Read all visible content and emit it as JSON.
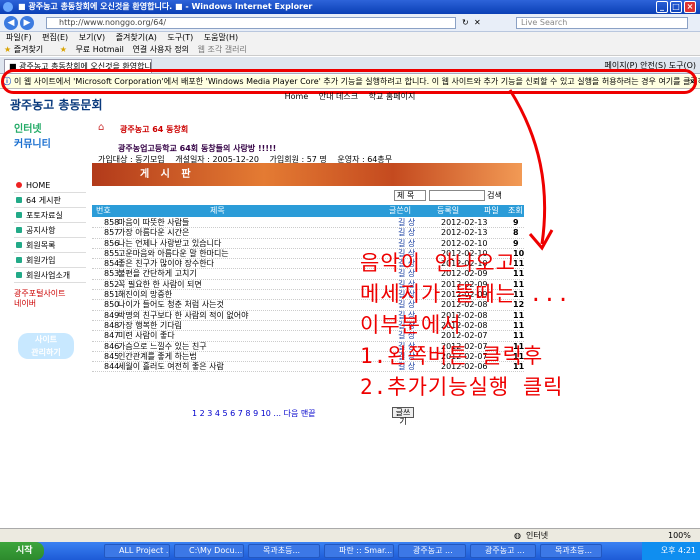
{
  "window": {
    "title": "■ 광주농고 총동창회에 오신것을 환영합니다. ■ - Windows Internet Explorer"
  },
  "addressbar": {
    "url": "http://www.nonggo.org/64/",
    "search_placeholder": "Live Search"
  },
  "menubar": {
    "items": [
      "파일(F)",
      "편집(E)",
      "보기(V)",
      "즐겨찾기(A)",
      "도구(T)",
      "도움말(H)"
    ]
  },
  "favbar": {
    "favorites": "즐겨찾기",
    "items": [
      "무료 Hotmail",
      "연결 사용자 정의",
      "웹 조각 갤러리"
    ]
  },
  "tabs": {
    "active": "■ 광주농고 총동창회에 오신것을 환영합니다.",
    "tools": "페이지(P)  안전(S)  도구(O)"
  },
  "infobar": {
    "text": "이 웹 사이트에서 'Microsoft Corporation'에서 배포한 'Windows Media Player Core' 추가 기능을 실행하려고 합니다. 이 웹 사이트와 추가 기능을 신뢰할 수 있고 실행을 허용하려는 경우 여기를 클릭하십시오.",
    "close": "×"
  },
  "site": {
    "topnav": [
      "Home",
      "안내 데스크",
      "학교 홈페이지"
    ],
    "name": "광주농고 총동문회",
    "logo": [
      "인터넷",
      "커뮤니티"
    ],
    "nav": [
      "HOME",
      "64 게시판",
      "포토자료실",
      "공지사항",
      "회원목록",
      "회원가입",
      "회원사업소개"
    ],
    "extra_links": [
      "광주포털사이트",
      "네이버"
    ],
    "badge": [
      "사이트",
      "관리하기"
    ]
  },
  "main": {
    "title": "광주농고 64 동창회",
    "desc": "광주농업고등학교 64회 동창들의 사랑방 !!!!!",
    "info": [
      "가입대상 : 동기모임",
      "개설일자 : 2005-12-20",
      "가입회원 : 57 명",
      "운영자 : 64총무"
    ],
    "board_banner": "게 시 판",
    "search_select": "제 목",
    "search_btn": "검색",
    "columns": [
      "번호",
      "제목",
      "글쓴이",
      "등록일",
      "파일",
      "조회"
    ],
    "rows": [
      {
        "no": "858",
        "title": "마음이 따뜻한 사람들",
        "author": "길 상",
        "date": "2012-02-13",
        "views": "9"
      },
      {
        "no": "857",
        "title": "가장 아름다운 시간은",
        "author": "길 상",
        "date": "2012-02-13",
        "views": "8"
      },
      {
        "no": "856",
        "title": "나는 언제나 사랑받고 있습니다",
        "author": "길 상",
        "date": "2012-02-10",
        "views": "9"
      },
      {
        "no": "855",
        "title": "고운마음와 아름다운 말 한마디는",
        "author": "길 상",
        "date": "2012-02-10",
        "views": "10"
      },
      {
        "no": "854",
        "title": "좋은 친구가 많이야 장수한다",
        "author": "길 상",
        "date": "2012-02-10",
        "views": "11"
      },
      {
        "no": "853",
        "title": "불편을 간단하게 고치기",
        "author": "길 상",
        "date": "2012-02-09",
        "views": "11"
      },
      {
        "no": "852",
        "title": "꼭 필요한 한 사람이 되면",
        "author": "길 상",
        "date": "2012-02-09",
        "views": "11"
      },
      {
        "no": "851",
        "title": "해진이의 망중한",
        "author": "길 상",
        "date": "2012-02-09",
        "views": "11"
      },
      {
        "no": "850",
        "title": "나이가 들어도 청춘 처럼 사는것",
        "author": "길 상",
        "date": "2012-02-08",
        "views": "12"
      },
      {
        "no": "849",
        "title": "박명의 친구보다 한 사람의 적이 없어야",
        "author": "길 상",
        "date": "2012-02-08",
        "views": "11"
      },
      {
        "no": "848",
        "title": "가장 행복한 기다림",
        "author": "길 상",
        "date": "2012-02-08",
        "views": "11"
      },
      {
        "no": "847",
        "title": "미련 사람이 좋다",
        "author": "길 상",
        "date": "2012-02-07",
        "views": "11"
      },
      {
        "no": "846",
        "title": "가슴으로 느낄수 있는 친구",
        "author": "길 상",
        "date": "2012-02-07",
        "views": "11"
      },
      {
        "no": "845",
        "title": "인간관계를 좋게 하는법",
        "author": "길 상",
        "date": "2012-02-07",
        "views": "11"
      },
      {
        "no": "844",
        "title": "세월이 흘러도 여전히 좋은 사람",
        "author": "길 상",
        "date": "2012-02-06",
        "views": "11"
      }
    ],
    "pager": "1 2 3 4 5 6 7 8 9 10 ... 다음 맨끝",
    "write_btn": "글쓰기"
  },
  "overlay": {
    "lines": [
      "음악이 안나오고",
      "메세지가 뜰때는 ...",
      "이부분에서",
      "1.왼쪽버튼 클릭후",
      "2.추가기능실행 클릭"
    ]
  },
  "statusbar": {
    "zone": "인터넷",
    "zoom": "100%"
  },
  "taskbar": {
    "start": "시작",
    "buttons": [
      "ALL Project ...",
      "C:\\My Docu...",
      "목과초등...",
      "파란 :: Smar...",
      "광주농고 ...",
      "광주농고 ...",
      "목과초등..."
    ],
    "clock": "오후 4:21"
  },
  "colors": {
    "annotation": "#ee0000",
    "board_header": "#2b9cd8",
    "titlebar": "#0a3fb5"
  }
}
